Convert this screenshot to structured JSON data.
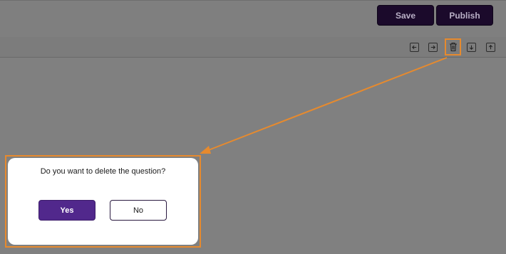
{
  "header": {
    "save_label": "Save",
    "publish_label": "Publish"
  },
  "toolbar": {
    "icons": [
      "move-left-icon",
      "move-right-icon",
      "trash-icon",
      "move-down-icon",
      "move-up-icon"
    ]
  },
  "dialog": {
    "message": "Do you want to delete the question?",
    "yes_label": "Yes",
    "no_label": "No"
  },
  "colors": {
    "overlay": "#808080",
    "dark_button": "#1b0a2b",
    "primary": "#51288c",
    "highlight": "#e68a2e"
  }
}
